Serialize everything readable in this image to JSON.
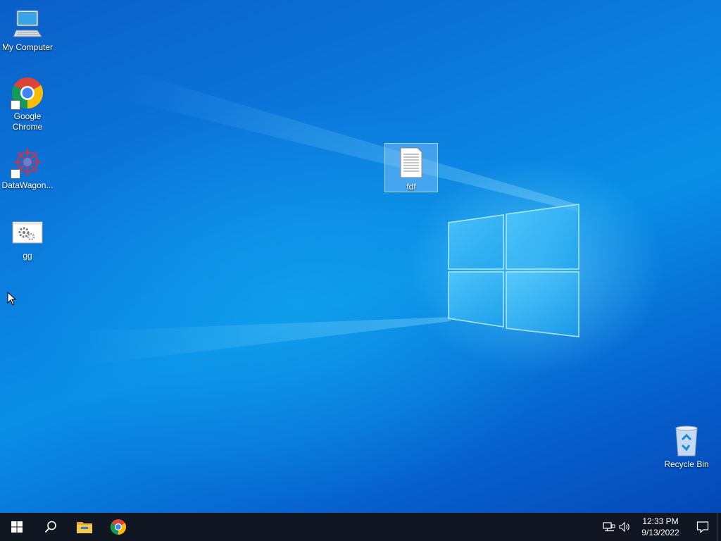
{
  "desktop": {
    "icons": [
      {
        "label": "My Computer",
        "icon": "monitor-icon"
      },
      {
        "label": "Google Chrome",
        "icon": "chrome-icon",
        "shortcut": true
      },
      {
        "label": "DataWagon...",
        "icon": "datawagon-icon",
        "shortcut": true
      },
      {
        "label": "gg",
        "icon": "settings-window-icon"
      },
      {
        "label": "fdf",
        "icon": "text-file-icon",
        "selected": true
      },
      {
        "label": "Recycle Bin",
        "icon": "recycle-bin-icon"
      }
    ]
  },
  "taskbar": {
    "start": "windows-logo-icon",
    "search": "search-icon",
    "pinned": [
      "file-explorer-icon",
      "chrome-icon"
    ],
    "tray": {
      "network": "network-icon",
      "volume": "volume-icon",
      "time": "12:33 PM",
      "date": "9/13/2022",
      "notifications": "notification-icon"
    }
  },
  "colors": {
    "taskbar_bg": "#101723",
    "selection": "#a0d2ff"
  }
}
